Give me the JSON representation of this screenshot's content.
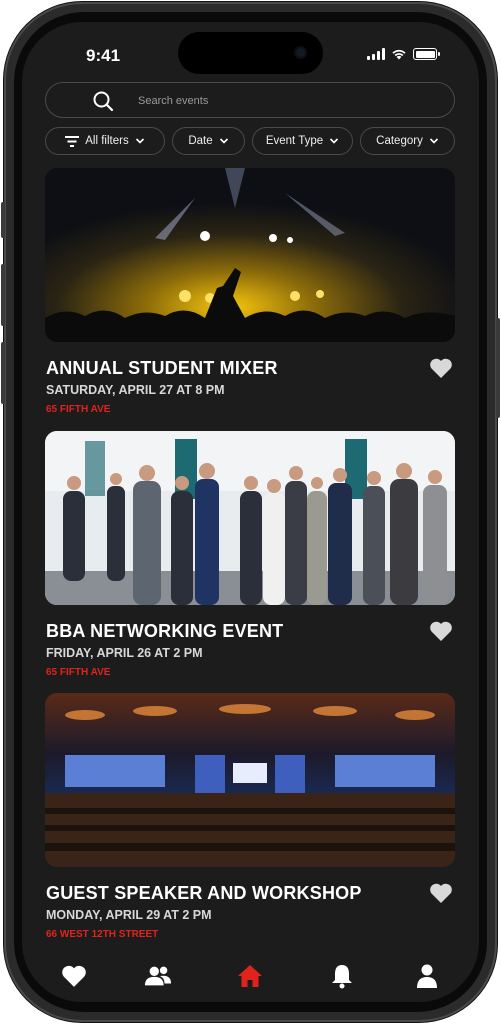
{
  "status_bar": {
    "time": "9:41"
  },
  "search": {
    "placeholder": "Search events"
  },
  "filters": [
    {
      "label": "All filters"
    },
    {
      "label": "Date"
    },
    {
      "label": "Event Type"
    },
    {
      "label": "Category"
    }
  ],
  "events": [
    {
      "title": "ANNUAL STUDENT MIXER",
      "date": "SATURDAY, APRIL 27 AT 8 PM",
      "location": "65 FIFTH AVE",
      "image": "concert-crowd-photo"
    },
    {
      "title": "BBA NETWORKING EVENT",
      "date": "FRIDAY, APRIL 26 AT 2 PM",
      "location": "65 FIFTH AVE",
      "image": "networking-people-photo"
    },
    {
      "title": "GUEST SPEAKER AND WORKSHOP",
      "date": "MONDAY, APRIL 29 AT 2 PM",
      "location": "66 WEST 12TH STREET",
      "image": "conference-hall-photo"
    }
  ],
  "tab_bar": {
    "items": [
      {
        "name": "favorites",
        "icon": "heart-icon"
      },
      {
        "name": "groups",
        "icon": "people-icon"
      },
      {
        "name": "home",
        "icon": "home-icon",
        "active": true
      },
      {
        "name": "notifications",
        "icon": "bell-icon"
      },
      {
        "name": "profile",
        "icon": "person-icon"
      }
    ]
  },
  "colors": {
    "background": "#1c1c1c",
    "accent_red": "#e0231c",
    "text": "#ffffff",
    "muted_text": "#d8d8d8"
  }
}
